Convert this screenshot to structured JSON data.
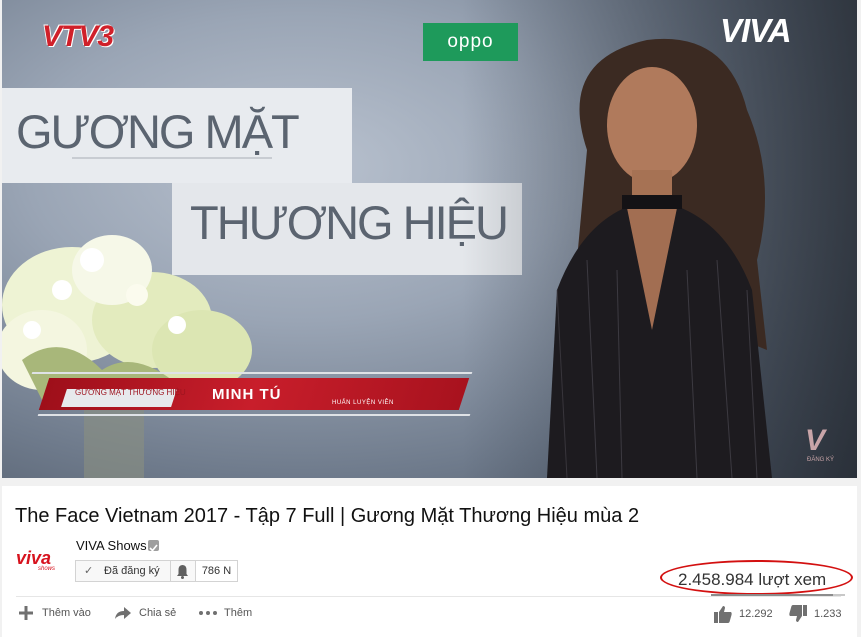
{
  "video": {
    "broadcaster_logo": "VTV3",
    "sponsor_logo": "oppo",
    "network_logo": "VIVA",
    "backdrop_line1": "GƯƠNG MẶT",
    "backdrop_line2": "THƯƠNG HIỆU",
    "lower_third": {
      "show_tag": "GƯƠNG MẶT THƯƠNG HIỆU",
      "name": "MINH TÚ",
      "role": "HUẤN LUYỆN VIÊN"
    },
    "corner_mark": "V",
    "corner_mark_sub": "ĐĂNG KÝ"
  },
  "info": {
    "title": "The Face Vietnam 2017 - Tập 7 Full | Gương Mặt Thương Hiệu mùa 2",
    "channel_logo_text": "viva",
    "channel_logo_sub": "shows",
    "channel_name": "VIVA Shows",
    "subscribe_label": "Đã đăng ký",
    "subscriber_count": "786 N",
    "views": "2.458.984 lượt xem",
    "actions": {
      "add_label": "Thêm vào",
      "share_label": "Chia sẻ",
      "more_label": "Thêm"
    },
    "likes": "12.292",
    "dislikes": "1.233",
    "like_ratio": 0.909
  },
  "icons": [
    "plus-icon",
    "share-arrow-icon",
    "more-dots-icon",
    "thumbs-up-icon",
    "thumbs-down-icon",
    "bell-icon",
    "check-icon",
    "verified-icon"
  ],
  "colors": {
    "accent_red": "#d31010",
    "oppo_green": "#1e9a5b",
    "lower_third_red": "#c81e2b"
  }
}
